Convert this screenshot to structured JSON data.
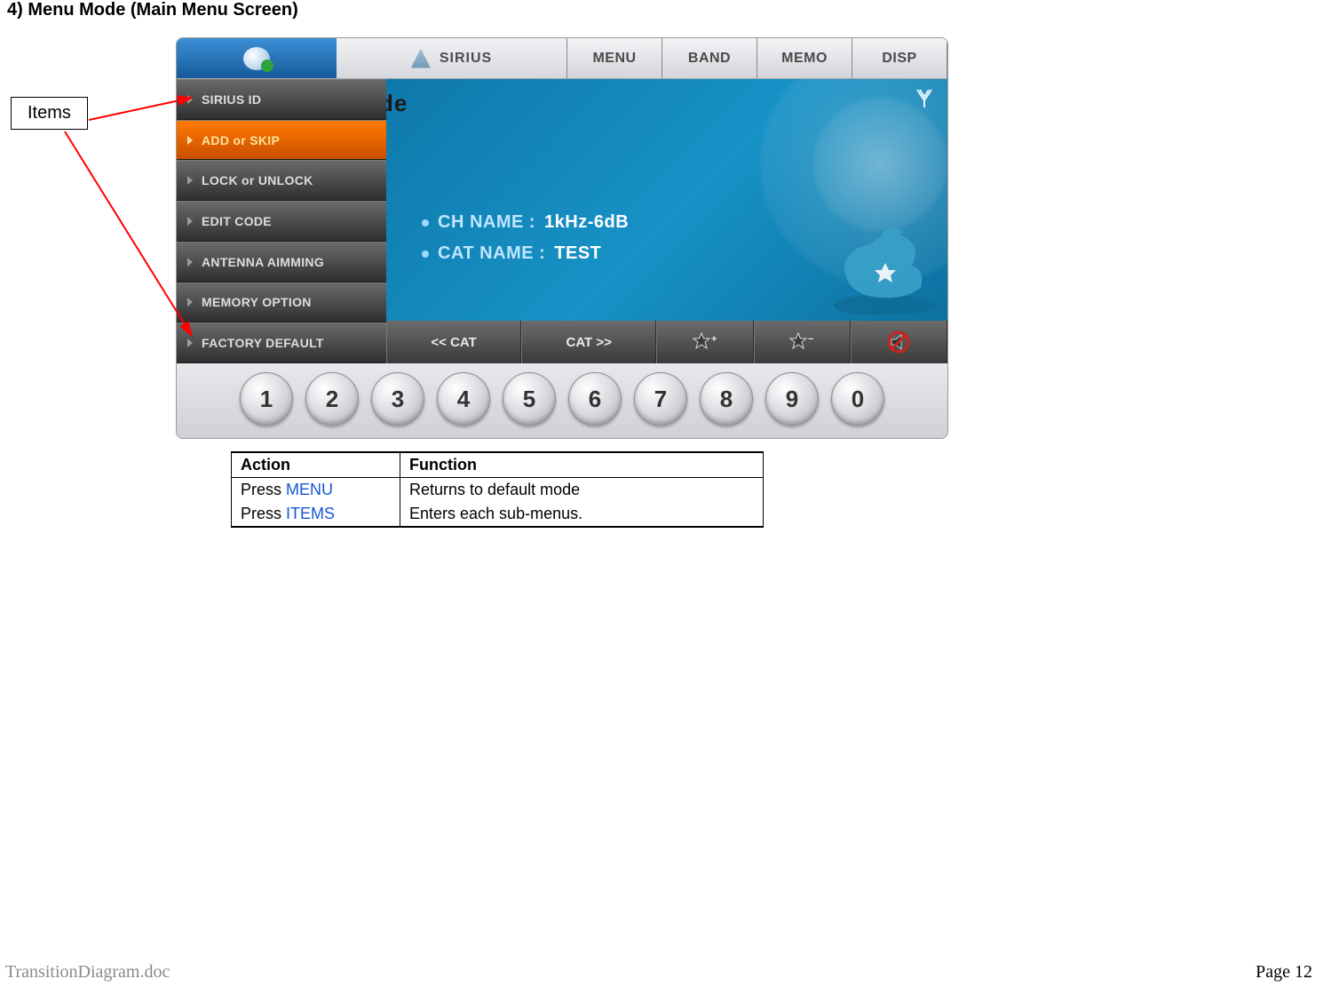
{
  "page": {
    "title": "4) Menu Mode (Main Menu Screen)",
    "callout_label": "Items",
    "footer_left": "TransitionDiagram.doc",
    "footer_right": "Page 12"
  },
  "topbar": {
    "sirius_label": "SIRIUS",
    "menu": "MENU",
    "band": "BAND",
    "memo": "MEMO",
    "disp": "DISP"
  },
  "sidemenu": {
    "items": [
      {
        "label": "SIRIUS ID",
        "active": false
      },
      {
        "label": "ADD or SKIP",
        "active": true
      },
      {
        "label": "LOCK or UNLOCK",
        "active": false
      },
      {
        "label": "EDIT CODE",
        "active": false
      },
      {
        "label": "ANTENNA AIMMING",
        "active": false
      },
      {
        "label": "MEMORY OPTION",
        "active": false
      },
      {
        "label": "FACTORY DEFAULT",
        "active": false
      }
    ]
  },
  "content": {
    "mode_fragment": "de",
    "ch_name_label": "CH NAME :",
    "ch_name_value": "1kHz-6dB",
    "cat_name_label": "CAT NAME :",
    "cat_name_value": "TEST"
  },
  "catbar": {
    "prev": "<< CAT",
    "next": "CAT >>"
  },
  "numbers": [
    "1",
    "2",
    "3",
    "4",
    "5",
    "6",
    "7",
    "8",
    "9",
    "0"
  ],
  "table": {
    "headers": {
      "action": "Action",
      "function": "Function"
    },
    "rows": [
      {
        "press": "Press ",
        "keyword": "MENU",
        "function": "Returns to default mode"
      },
      {
        "press": "Press ",
        "keyword": "ITEMS",
        "function": "Enters each sub-menus."
      }
    ]
  }
}
